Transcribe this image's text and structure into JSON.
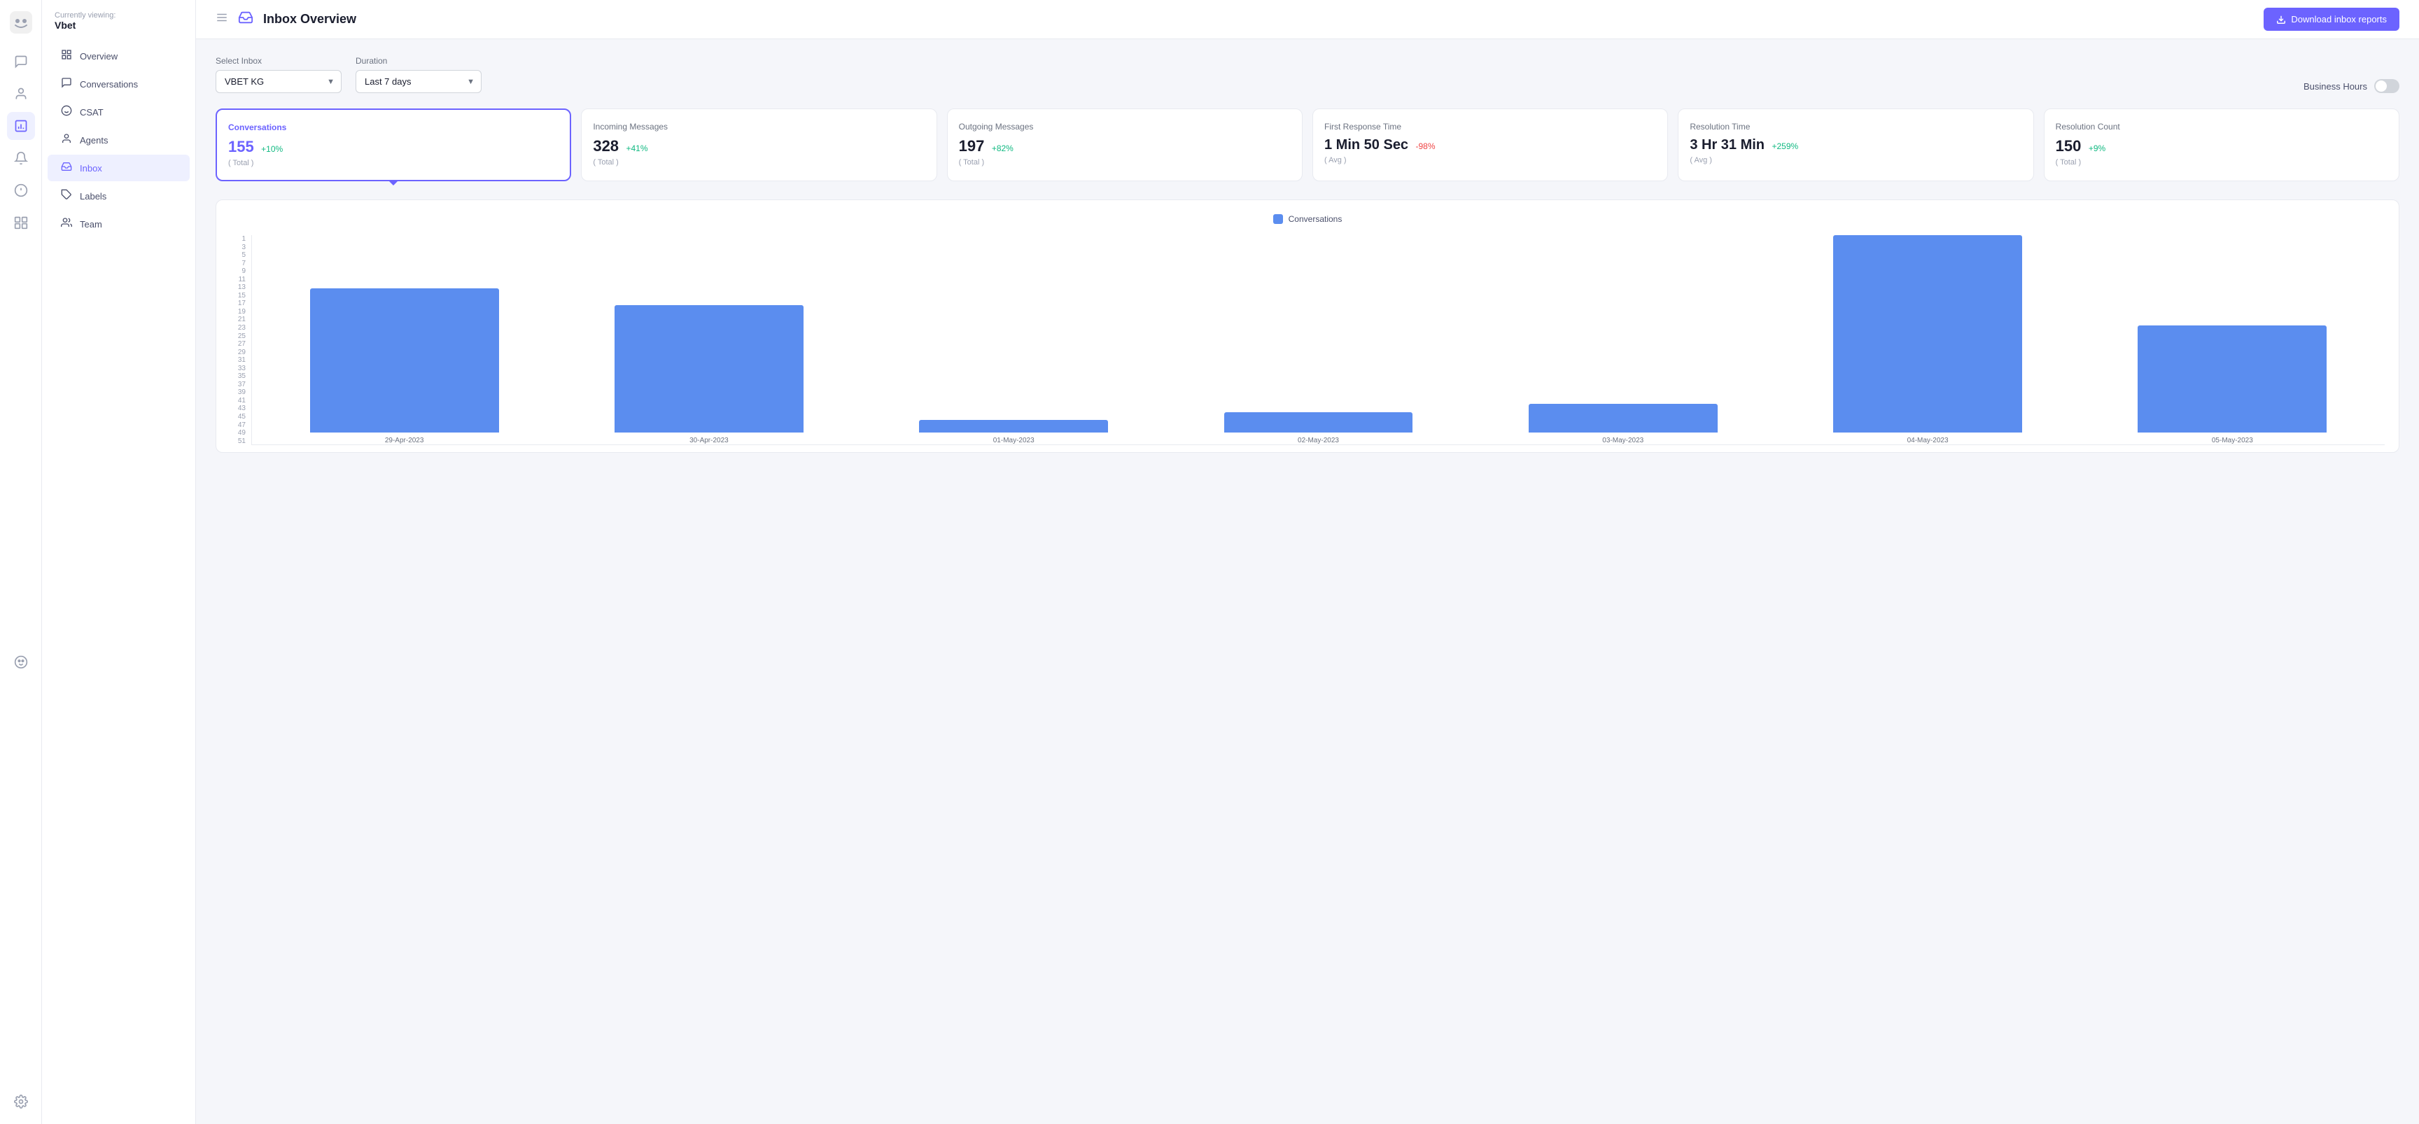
{
  "app": {
    "logo_text": "🤖",
    "currently_viewing_label": "Currently viewing:",
    "org_name": "Vbet"
  },
  "topbar": {
    "title": "Inbox Overview",
    "download_btn_label": "Download inbox reports"
  },
  "nav_icons": [
    {
      "name": "conversations-icon",
      "icon": "💬",
      "active": false
    },
    {
      "name": "contacts-icon",
      "icon": "👤",
      "active": false
    },
    {
      "name": "reports-icon",
      "icon": "📊",
      "active": true
    },
    {
      "name": "notifications-icon",
      "icon": "🔔",
      "active": false
    },
    {
      "name": "integrations-icon",
      "icon": "🔗",
      "active": false
    },
    {
      "name": "bot-icon",
      "icon": "🤖",
      "active": false
    }
  ],
  "sidebar": {
    "items": [
      {
        "id": "overview",
        "label": "Overview",
        "icon": "⊞",
        "active": false
      },
      {
        "id": "conversations",
        "label": "Conversations",
        "icon": "💬",
        "active": false
      },
      {
        "id": "csat",
        "label": "CSAT",
        "icon": "◎",
        "active": false
      },
      {
        "id": "agents",
        "label": "Agents",
        "icon": "👤",
        "active": false
      },
      {
        "id": "inbox",
        "label": "Inbox",
        "icon": "📥",
        "active": true
      },
      {
        "id": "labels",
        "label": "Labels",
        "icon": "🏷",
        "active": false
      },
      {
        "id": "team",
        "label": "Team",
        "icon": "👥",
        "active": false
      }
    ]
  },
  "filters": {
    "inbox_label": "Select Inbox",
    "inbox_value": "VBET KG",
    "duration_label": "Duration",
    "duration_value": "Last 7 days",
    "business_hours_label": "Business Hours"
  },
  "stats": [
    {
      "id": "conversations",
      "label": "Conversations",
      "value": "155",
      "change": "+10%",
      "change_type": "positive",
      "period": "( Total )",
      "active": true
    },
    {
      "id": "incoming",
      "label": "Incoming Messages",
      "value": "328",
      "change": "+41%",
      "change_type": "positive",
      "period": "( Total )",
      "active": false
    },
    {
      "id": "outgoing",
      "label": "Outgoing Messages",
      "value": "197",
      "change": "+82%",
      "change_type": "positive",
      "period": "( Total )",
      "active": false
    },
    {
      "id": "first_response",
      "label": "First Response Time",
      "value": "1 Min 50 Sec",
      "change": "-98%",
      "change_type": "negative",
      "period": "( Avg )",
      "active": false
    },
    {
      "id": "resolution_time",
      "label": "Resolution Time",
      "value": "3 Hr 31 Min",
      "change": "+259%",
      "change_type": "positive",
      "period": "( Avg )",
      "active": false
    },
    {
      "id": "resolution_count",
      "label": "Resolution Count",
      "value": "150",
      "change": "+9%",
      "change_type": "positive",
      "period": "( Total )",
      "active": false
    }
  ],
  "chart": {
    "legend_label": "Conversations",
    "y_axis": [
      "51",
      "49",
      "47",
      "45",
      "43",
      "41",
      "39",
      "37",
      "35",
      "33",
      "31",
      "29",
      "27",
      "25",
      "23",
      "21",
      "19",
      "17",
      "15",
      "13",
      "11",
      "9",
      "7",
      "5",
      "3",
      "1"
    ],
    "bars": [
      {
        "date": "29-Apr-2023",
        "value": 35,
        "height_pct": 68
      },
      {
        "date": "30-Apr-2023",
        "value": 31,
        "height_pct": 60
      },
      {
        "date": "01-May-2023",
        "value": 3,
        "height_pct": 5
      },
      {
        "date": "02-May-2023",
        "value": 5,
        "height_pct": 9
      },
      {
        "date": "03-May-2023",
        "value": 7,
        "height_pct": 13
      },
      {
        "date": "04-May-2023",
        "value": 50,
        "height_pct": 97
      },
      {
        "date": "05-May-2023",
        "value": 26,
        "height_pct": 50
      }
    ]
  }
}
